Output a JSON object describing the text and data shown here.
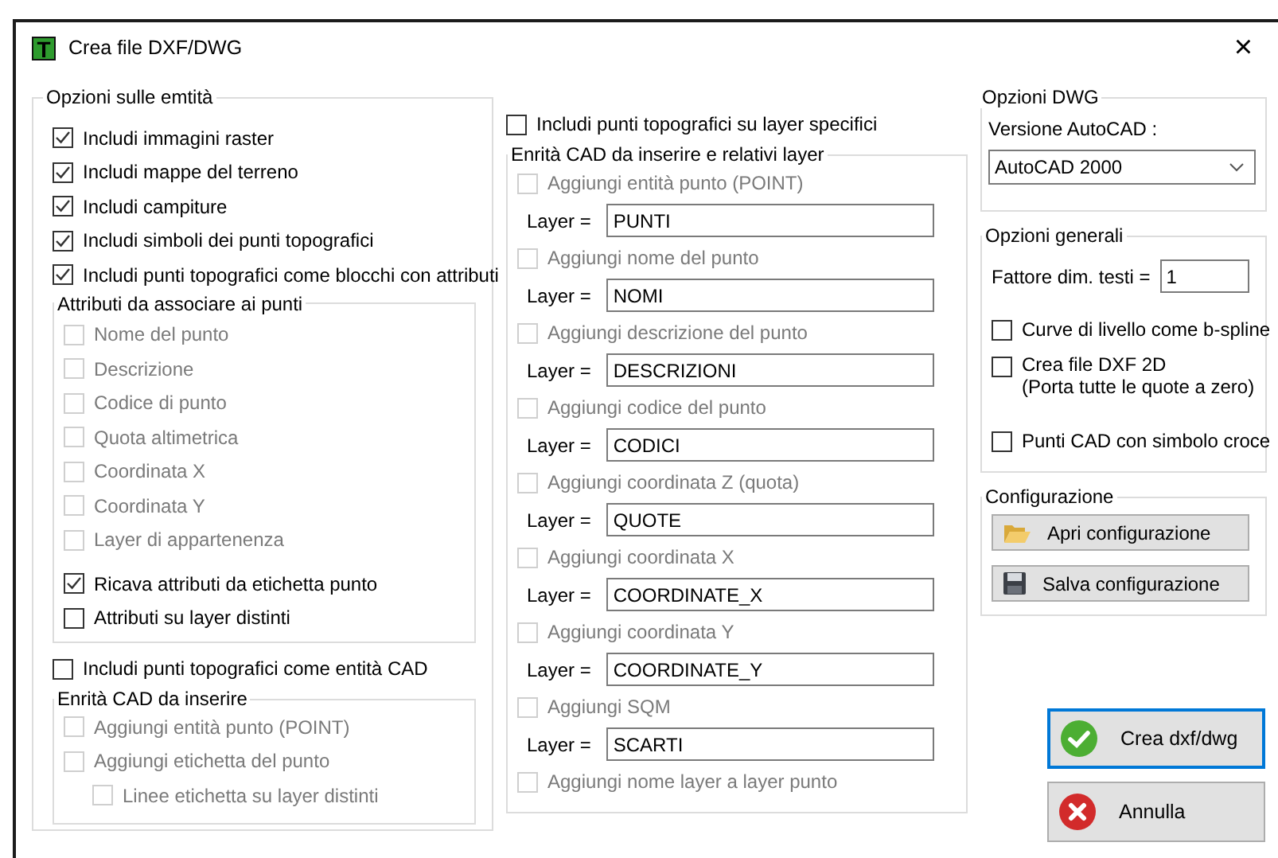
{
  "window": {
    "logo": "T",
    "title": "Crea file DXF/DWG",
    "close": "×"
  },
  "entity_options": {
    "title": "Opzioni sulle emtità",
    "items": [
      {
        "label": "Includi immagini raster",
        "checked": true,
        "disabled": false
      },
      {
        "label": "Includi mappe del terreno",
        "checked": true,
        "disabled": false
      },
      {
        "label": "Includi campiture",
        "checked": true,
        "disabled": false
      },
      {
        "label": "Includi simboli dei punti topografici",
        "checked": true,
        "disabled": false
      },
      {
        "label": "Includi punti topografici come blocchi con attributi",
        "checked": true,
        "disabled": false
      }
    ],
    "attributes": {
      "title": "Attributi da associare ai punti",
      "items": [
        {
          "label": "Nome del punto",
          "checked": false,
          "disabled": true
        },
        {
          "label": "Descrizione",
          "checked": false,
          "disabled": true
        },
        {
          "label": "Codice di punto",
          "checked": false,
          "disabled": true
        },
        {
          "label": "Quota altimetrica",
          "checked": false,
          "disabled": true
        },
        {
          "label": "Coordinata X",
          "checked": false,
          "disabled": true
        },
        {
          "label": "Coordinata Y",
          "checked": false,
          "disabled": true
        },
        {
          "label": "Layer di appartenenza",
          "checked": false,
          "disabled": true
        }
      ],
      "options": [
        {
          "label": "Ricava attributi da etichetta punto",
          "checked": true,
          "disabled": false
        },
        {
          "label": "Attributi su layer distinti",
          "checked": false,
          "disabled": false
        }
      ]
    },
    "cad_option": {
      "label": "Includi punti topografici come entità CAD",
      "checked": false,
      "disabled": false
    },
    "cad_group": {
      "title": "Enrità CAD da inserire",
      "items": [
        {
          "label": "Aggiungi entità punto (POINT)",
          "checked": false,
          "disabled": true
        },
        {
          "label": "Aggiungi etichetta del punto",
          "checked": false,
          "disabled": true,
          "children": [
            {
              "label": "Linee etichetta su layer distinti",
              "checked": false,
              "disabled": true
            }
          ]
        }
      ]
    }
  },
  "layers": {
    "option": {
      "label": "Includi punti topografici su layer specifici",
      "checked": false,
      "disabled": false
    },
    "title": "Enrità CAD da inserire e relativi layer",
    "items": [
      {
        "label": "Aggiungi entità punto (POINT)",
        "checked": false,
        "disabled": true,
        "layer_label": "Layer =",
        "layer": "PUNTI"
      },
      {
        "label": "Aggiungi nome del punto",
        "checked": false,
        "disabled": true,
        "layer_label": "Layer =",
        "layer": "NOMI"
      },
      {
        "label": "Aggiungi descrizione del punto",
        "checked": false,
        "disabled": true,
        "layer_label": "Layer =",
        "layer": "DESCRIZIONI"
      },
      {
        "label": "Aggiungi codice del punto",
        "checked": false,
        "disabled": true,
        "layer_label": "Layer =",
        "layer": "CODICI"
      },
      {
        "label": "Aggiungi coordinata Z (quota)",
        "checked": false,
        "disabled": true,
        "layer_label": "Layer =",
        "layer": "QUOTE"
      },
      {
        "label": "Aggiungi coordinata X",
        "checked": false,
        "disabled": true,
        "layer_label": "Layer =",
        "layer": "COORDINATE_X"
      },
      {
        "label": "Aggiungi coordinata Y",
        "checked": false,
        "disabled": true,
        "layer_label": "Layer =",
        "layer": "COORDINATE_Y"
      },
      {
        "label": "Aggiungi SQM",
        "checked": false,
        "disabled": true,
        "layer_label": "Layer =",
        "layer": "SCARTI"
      },
      {
        "label": "Aggiungi nome layer a layer punto",
        "checked": false,
        "disabled": true
      }
    ]
  },
  "dwg_options": {
    "title": "Opzioni DWG",
    "version_label": "Versione AutoCAD :",
    "version": "AutoCAD 2000"
  },
  "general_options": {
    "title": "Opzioni generali",
    "factor_label": "Fattore dim. testi =",
    "factor": "1",
    "items": [
      {
        "label": "Curve di livello come b-spline",
        "checked": false,
        "disabled": false
      },
      {
        "label": "Crea file DXF 2D",
        "note": "(Porta tutte le quote a zero)",
        "checked": false,
        "disabled": false
      },
      {
        "label": "Punti CAD con simbolo croce",
        "checked": false,
        "disabled": false
      }
    ]
  },
  "configuration": {
    "title": "Configurazione",
    "buttons": [
      {
        "label": "Apri configurazione",
        "kind": "open"
      },
      {
        "label": "Salva configurazione",
        "kind": "save"
      }
    ]
  },
  "actions": [
    {
      "label": "Crea dxf/dwg",
      "kind": "ok",
      "focused": true
    },
    {
      "label": "Annulla",
      "kind": "cancel",
      "focused": false
    }
  ]
}
